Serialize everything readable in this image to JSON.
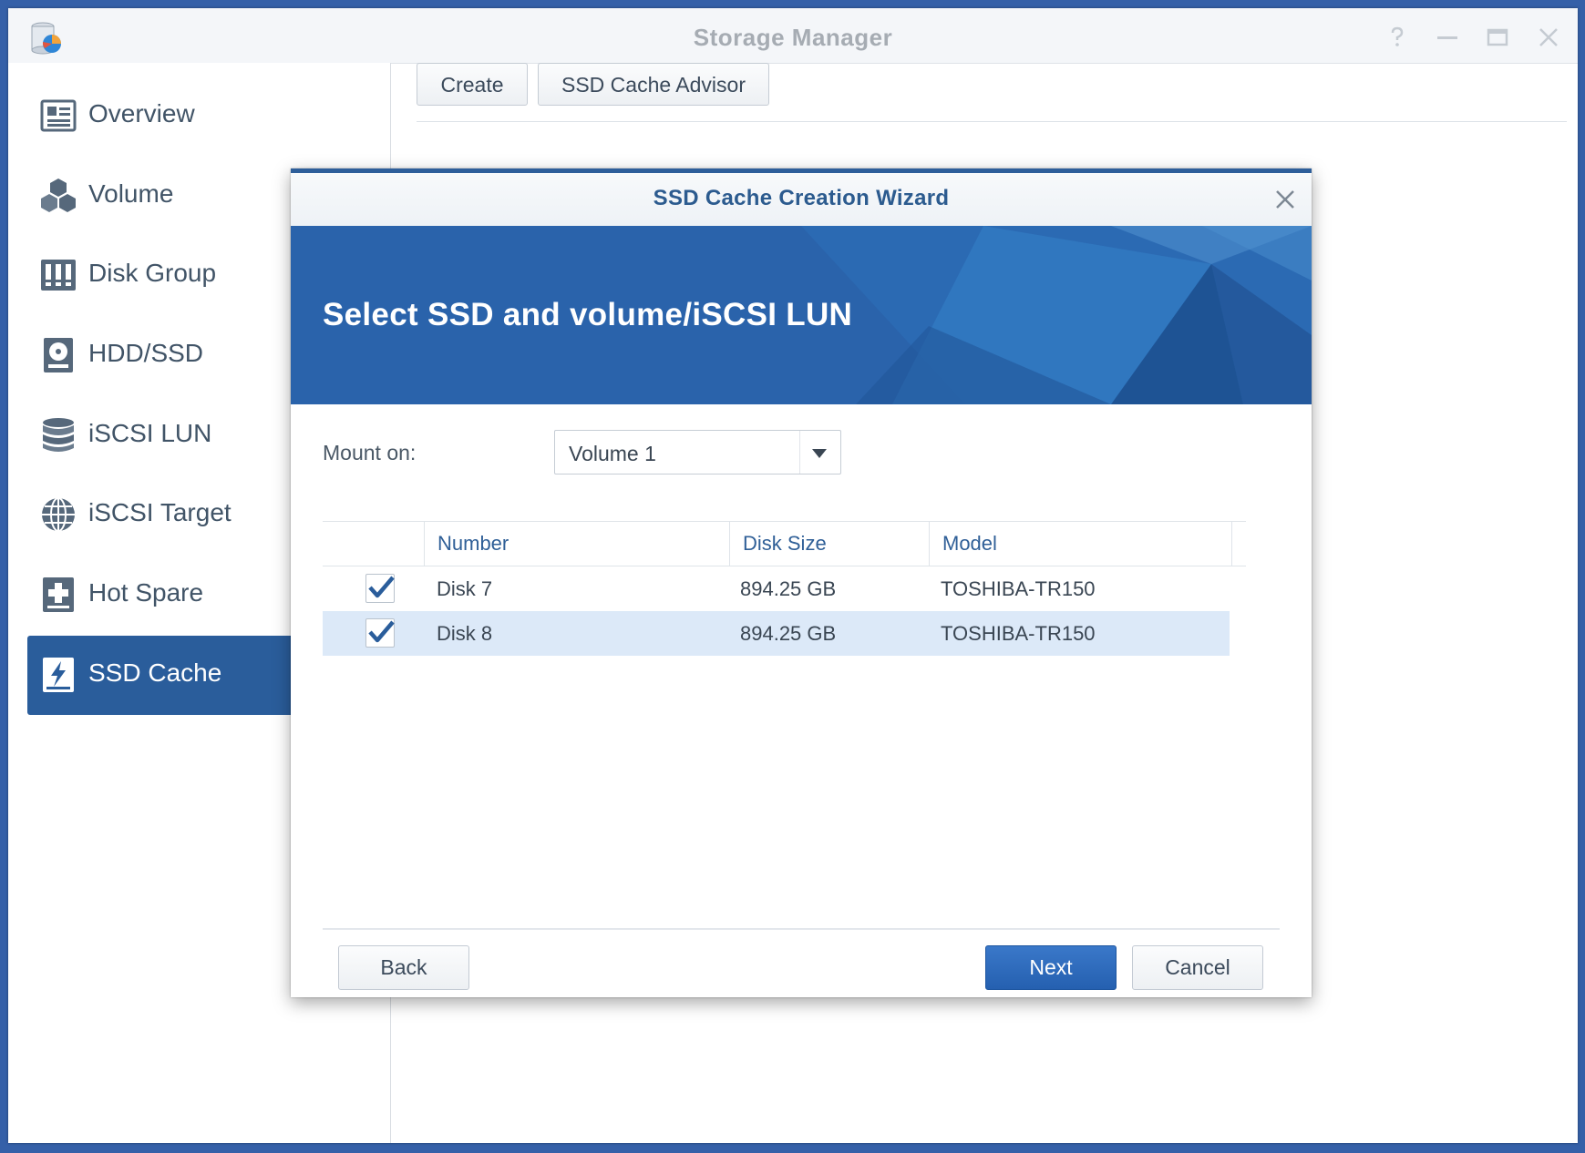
{
  "window": {
    "title": "Storage Manager",
    "controls": [
      "help-icon",
      "minimize-icon",
      "maximize-icon",
      "close-icon"
    ]
  },
  "sidebar": {
    "items": [
      {
        "label": "Overview",
        "icon": "overview-icon",
        "active": false
      },
      {
        "label": "Volume",
        "icon": "volume-icon",
        "active": false
      },
      {
        "label": "Disk Group",
        "icon": "disk-group-icon",
        "active": false
      },
      {
        "label": "HDD/SSD",
        "icon": "hdd-icon",
        "active": false
      },
      {
        "label": "iSCSI LUN",
        "icon": "database-icon",
        "active": false
      },
      {
        "label": "iSCSI Target",
        "icon": "globe-icon",
        "active": false
      },
      {
        "label": "Hot Spare",
        "icon": "hot-spare-icon",
        "active": false
      },
      {
        "label": "SSD Cache",
        "icon": "ssd-cache-icon",
        "active": true
      }
    ]
  },
  "toolbar": {
    "create_label": "Create",
    "advisor_label": "SSD Cache Advisor"
  },
  "dialog": {
    "title": "SSD Cache Creation Wizard",
    "banner_title": "Select SSD and volume/iSCSI LUN",
    "mount_label": "Mount on:",
    "mount_value": "Volume 1",
    "table": {
      "columns": [
        "Number",
        "Disk Size",
        "Model"
      ],
      "rows": [
        {
          "checked": true,
          "number": "Disk 7",
          "size": "894.25 GB",
          "model": "TOSHIBA-TR150",
          "selected": false
        },
        {
          "checked": true,
          "number": "Disk 8",
          "size": "894.25 GB",
          "model": "TOSHIBA-TR150",
          "selected": true
        }
      ]
    },
    "buttons": {
      "back": "Back",
      "next": "Next",
      "cancel": "Cancel"
    }
  },
  "colors": {
    "accent": "#2a5d9b",
    "banner": "#2a63ab",
    "primary_button": "#2560b0",
    "selected_row": "#dce9f8"
  }
}
